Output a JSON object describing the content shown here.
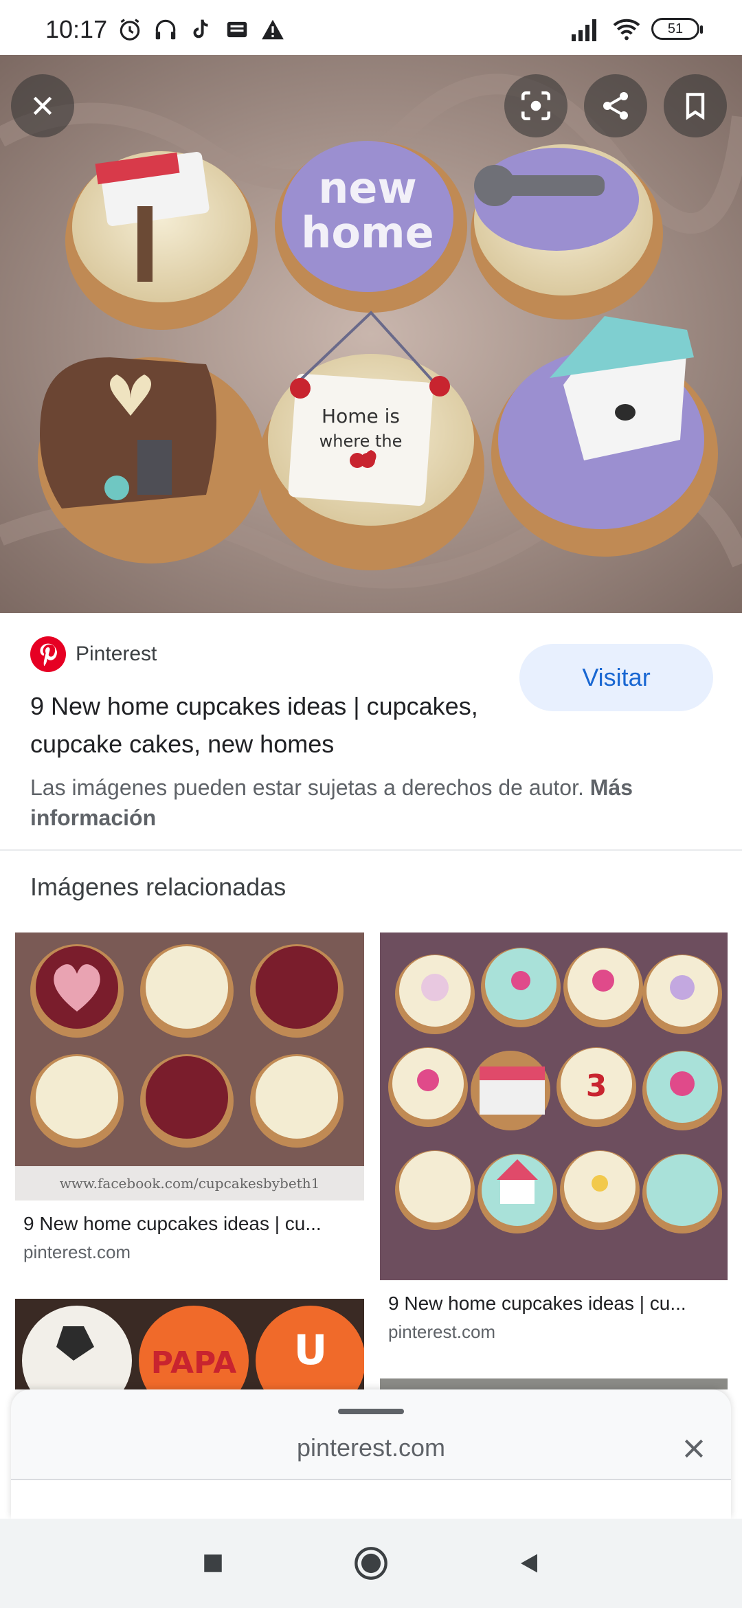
{
  "status_bar": {
    "time": "10:17",
    "battery": "51",
    "icons": [
      "alarm-icon",
      "headset-icon",
      "tiktok-icon",
      "news-icon",
      "warning-icon",
      "signal-icon",
      "wifi-icon",
      "battery-icon"
    ]
  },
  "hero": {
    "close_icon": "close-icon",
    "actions": [
      "lens-icon",
      "share-icon",
      "bookmark-icon"
    ]
  },
  "result": {
    "source_name": "Pinterest",
    "source_color": "#e60023",
    "visit_label": "Visitar",
    "title": "9 New home cupcakes ideas | cupcakes, cupcake cakes, new homes",
    "copyright_text": "Las imágenes pueden estar sujetas a derechos de autor.",
    "copyright_link": "Más información"
  },
  "related": {
    "heading": "Imágenes relacionadas",
    "items": [
      {
        "title": "9 New home cupcakes ideas | cu...",
        "domain": "pinterest.com"
      },
      {
        "title": "9 New home cupcakes ideas | cu...",
        "domain": "pinterest.com"
      }
    ]
  },
  "sheet": {
    "domain": "pinterest.com"
  },
  "navbar": {
    "buttons": [
      "recents-button",
      "home-button",
      "back-button"
    ]
  },
  "colors": {
    "accent": "#1967d2",
    "visit_bg": "#e8f0fe"
  }
}
